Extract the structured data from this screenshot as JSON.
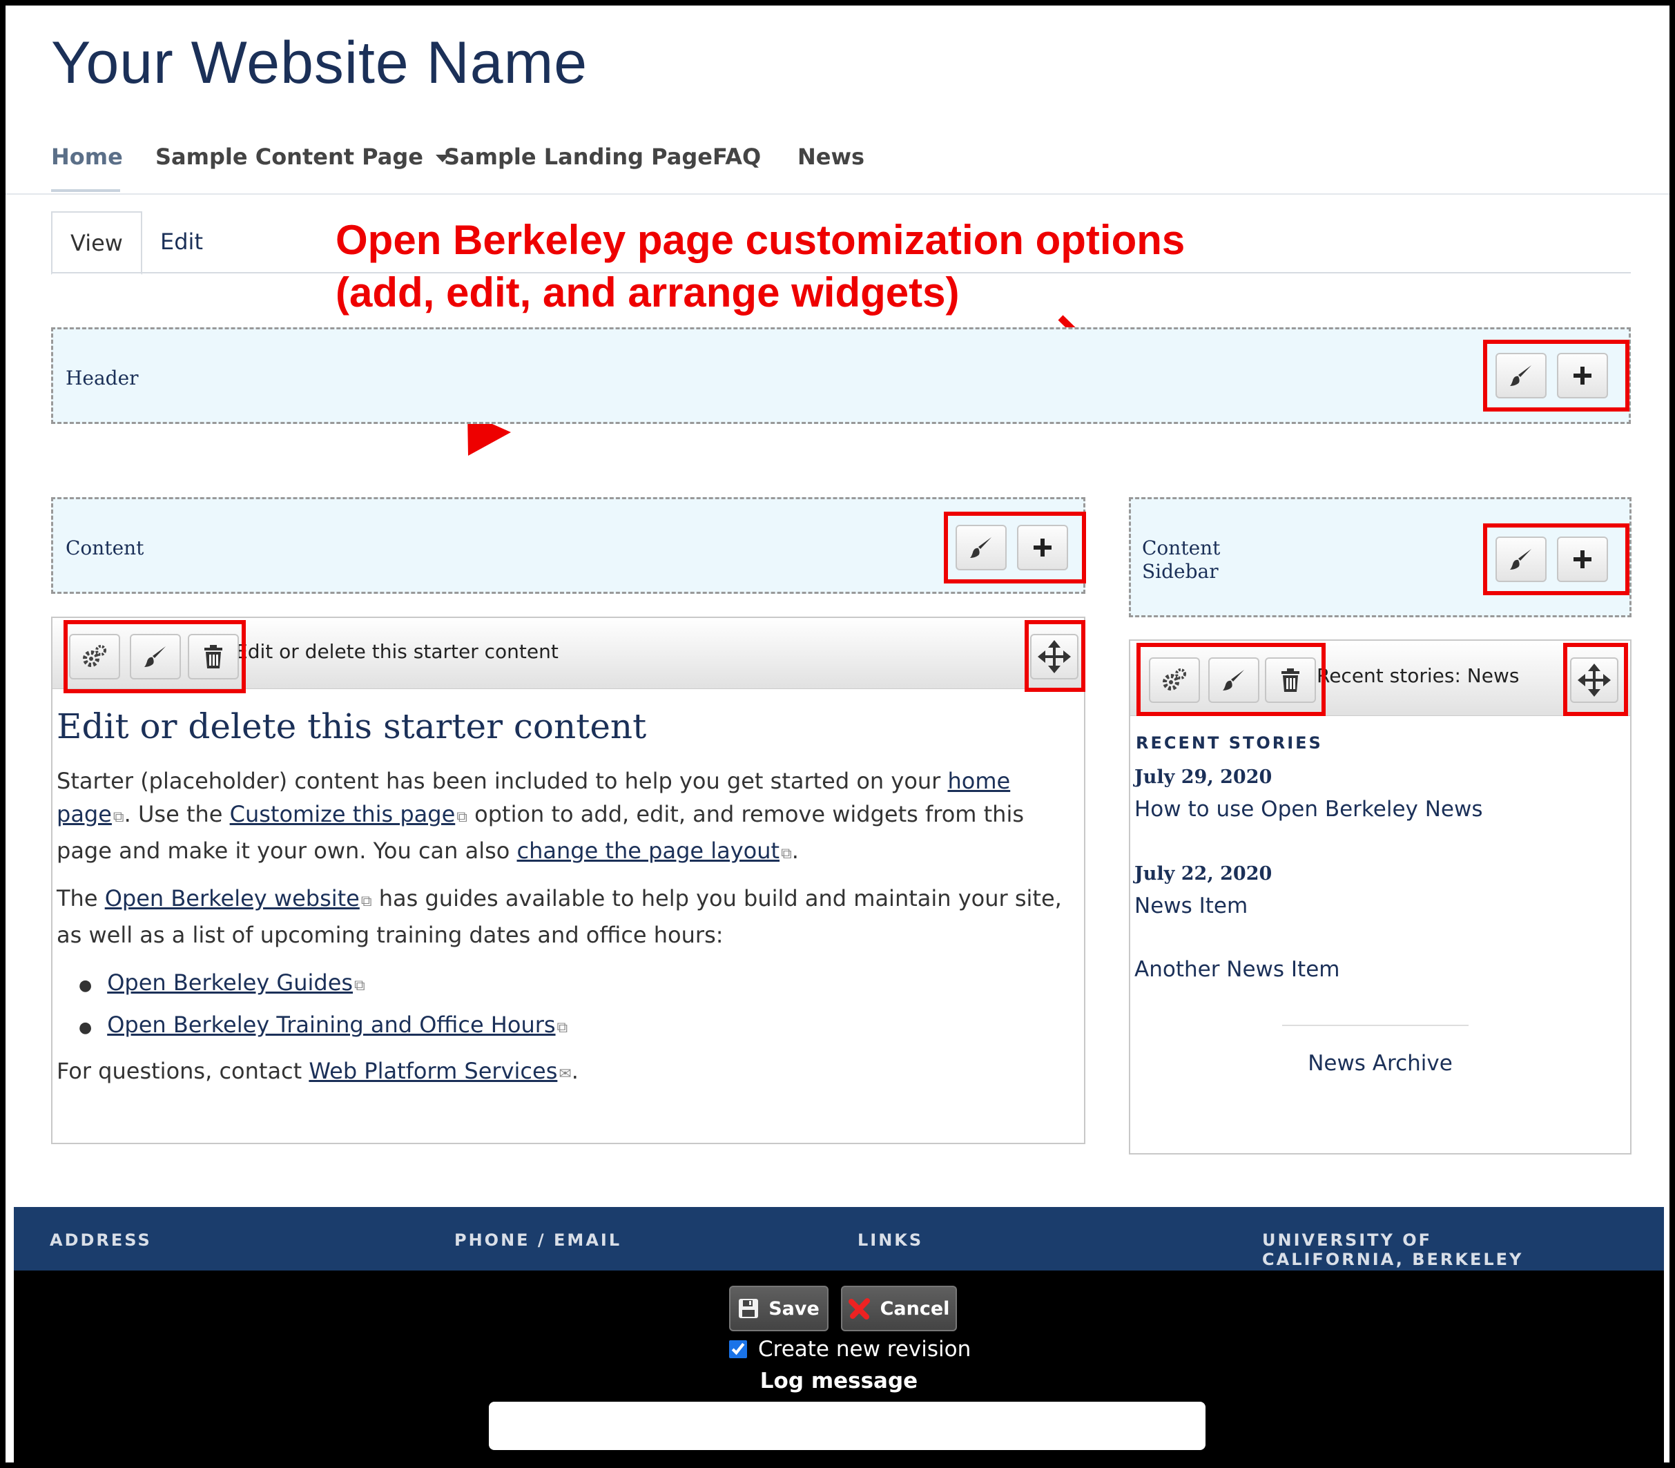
{
  "site": {
    "name": "Your Website Name"
  },
  "nav": {
    "items": [
      "Home",
      "Sample Content Page",
      "Sample Landing Page",
      "FAQ",
      "News"
    ]
  },
  "tabs": {
    "view": "View",
    "edit": "Edit"
  },
  "annotation": {
    "line1": "Open Berkeley page customization options",
    "line2": "(add, edit, and arrange widgets)",
    "color": "#ee0000"
  },
  "regions": {
    "header": "Header",
    "content": "Content",
    "sidebar_line1": "Content",
    "sidebar_line2": "Sidebar"
  },
  "main_pane": {
    "bar_title": "Edit or delete this starter content",
    "heading": "Edit or delete this starter content",
    "p1": {
      "a": "Starter (placeholder) content has been included to help you get started on your ",
      "link1": "home page",
      "b": ". Use the ",
      "link2": "Customize this page",
      "c": " option to add, edit, and remove widgets from this page and make it your own. You can also ",
      "link3": "change the page layout",
      "d": "."
    },
    "p2": {
      "a": "The ",
      "link": "Open Berkeley website",
      "b": " has guides available to help you build and maintain your site, as well as a list of upcoming training dates and office hours:"
    },
    "list": [
      "Open Berkeley Guides",
      "Open Berkeley Training and Office Hours"
    ],
    "p3": {
      "a": "For questions, contact ",
      "link": "Web Platform Services",
      "b": "."
    }
  },
  "sidebar_pane": {
    "bar_title": "Recent stories: News",
    "section_title": "RECENT STORIES",
    "stories": [
      {
        "date": "July 29, 2020",
        "title": "How to use Open Berkeley News"
      },
      {
        "date": "July 22, 2020",
        "title": "News Item"
      },
      {
        "date": "",
        "title": "Another News Item"
      }
    ],
    "archive": "News Archive"
  },
  "footer": {
    "columns": [
      "ADDRESS",
      "PHONE / EMAIL",
      "LINKS",
      "UNIVERSITY OF CALIFORNIA, BERKELEY"
    ]
  },
  "editbar": {
    "save": "Save",
    "cancel": "Cancel",
    "revision_label": "Create new revision",
    "revision_checked": true,
    "log_label": "Log message",
    "log_value": ""
  },
  "icons": {
    "brush": "paintbrush-icon",
    "plus": "plus-icon",
    "gear": "gears-icon",
    "trash": "trash-icon",
    "move": "move-arrows-icon",
    "caret": "caret-down-icon",
    "save": "floppy-disk-icon",
    "cancel": "red-x-icon",
    "external": "external-link-icon",
    "mail": "mail-icon"
  },
  "colors": {
    "navy": "#1b3058",
    "footer_blue": "#1b3d6c",
    "region_bg": "#ecf8fd"
  }
}
